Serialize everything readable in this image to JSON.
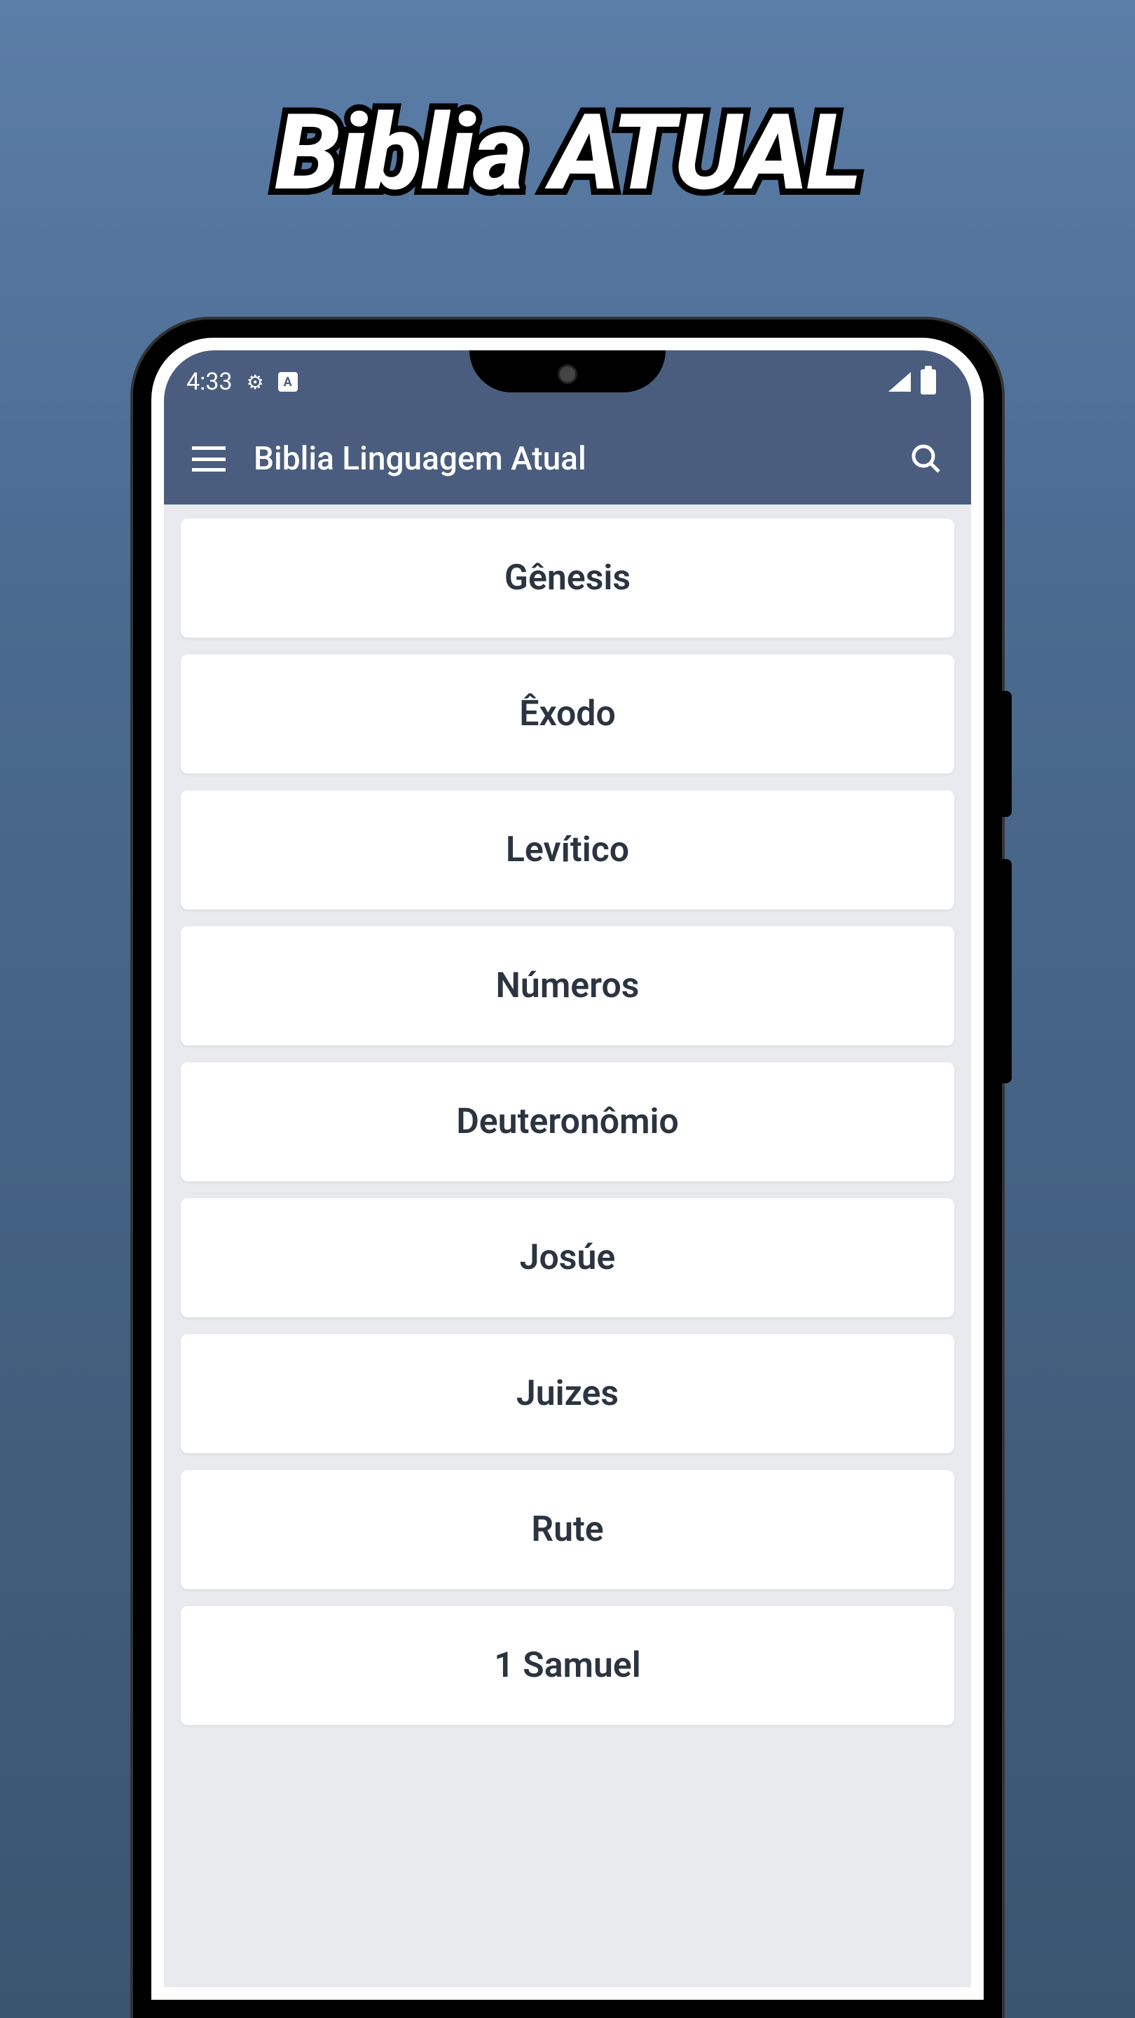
{
  "hero": {
    "title": "Biblia ATUAL"
  },
  "statusBar": {
    "time": "4:33",
    "badgeLetter": "A"
  },
  "appBar": {
    "title": "Biblia Linguagem Atual"
  },
  "books": [
    "Gênesis",
    "Êxodo",
    "Levítico",
    "Números",
    "Deuteronômio",
    "Josúe",
    "Juizes",
    "Rute",
    "1 Samuel"
  ]
}
